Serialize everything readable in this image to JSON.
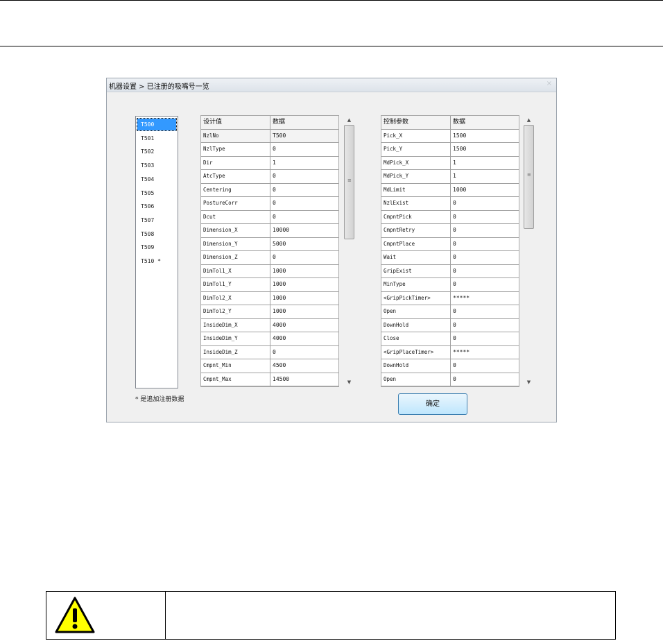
{
  "window": {
    "title": "机器设置 > 已注册的吸嘴号一览",
    "close_glyph": "×"
  },
  "nozzle_list": {
    "items": [
      "T500",
      "T501",
      "T502",
      "T503",
      "T504",
      "T505",
      "T506",
      "T507",
      "T508",
      "T509",
      "T510 *"
    ],
    "selected": "T500"
  },
  "footnote": "* 是追加注册数据",
  "design_table": {
    "header": {
      "name": "设计值",
      "value": "数据"
    },
    "rows": [
      {
        "name": "NzlNo",
        "value": "T500"
      },
      {
        "name": "NzlType",
        "value": "0"
      },
      {
        "name": "Dir",
        "value": "1"
      },
      {
        "name": "AtcType",
        "value": "0"
      },
      {
        "name": "Centering",
        "value": "0"
      },
      {
        "name": "PostureCorr",
        "value": "0"
      },
      {
        "name": "Dcut",
        "value": "0"
      },
      {
        "name": "Dimension_X",
        "value": "10000"
      },
      {
        "name": "Dimension_Y",
        "value": "5000"
      },
      {
        "name": "Dimension_Z",
        "value": "0"
      },
      {
        "name": "DimTol1_X",
        "value": "1000"
      },
      {
        "name": "DimTol1_Y",
        "value": "1000"
      },
      {
        "name": "DimTol2_X",
        "value": "1000"
      },
      {
        "name": "DimTol2_Y",
        "value": "1000"
      },
      {
        "name": "InsideDim_X",
        "value": "4000"
      },
      {
        "name": "InsideDim_Y",
        "value": "4000"
      },
      {
        "name": "InsideDim_Z",
        "value": "0"
      },
      {
        "name": "Cmpnt_Min",
        "value": "4500"
      },
      {
        "name": "Cmpnt_Max",
        "value": "14500"
      }
    ]
  },
  "control_table": {
    "header": {
      "name": "控制参数",
      "value": "数据"
    },
    "rows": [
      {
        "name": "Pick_X",
        "value": "1500"
      },
      {
        "name": "Pick_Y",
        "value": "1500"
      },
      {
        "name": "MdPick_X",
        "value": "1"
      },
      {
        "name": "MdPick_Y",
        "value": "1"
      },
      {
        "name": "MdLimit",
        "value": "1000"
      },
      {
        "name": "NzlExist",
        "value": "0"
      },
      {
        "name": "CmpntPick",
        "value": "0"
      },
      {
        "name": "CmpntRetry",
        "value": "0"
      },
      {
        "name": "CmpntPlace",
        "value": "0"
      },
      {
        "name": "Wait",
        "value": "0"
      },
      {
        "name": "GripExist",
        "value": "0"
      },
      {
        "name": "MinType",
        "value": "0"
      },
      {
        "name": "<GripPickTimer>",
        "value": "*****"
      },
      {
        "name": "Open",
        "value": "0"
      },
      {
        "name": "DownHold",
        "value": "0"
      },
      {
        "name": "Close",
        "value": "0"
      },
      {
        "name": "<GripPlaceTimer>",
        "value": "*****"
      },
      {
        "name": "DownHold",
        "value": "0"
      },
      {
        "name": "Open",
        "value": "0"
      }
    ]
  },
  "scrollbar": {
    "up": "▲",
    "down": "▼",
    "grip": "≡"
  },
  "ok_button": "确定",
  "icons": {
    "warning": "warning-icon",
    "warning_color": "#ffff00"
  }
}
